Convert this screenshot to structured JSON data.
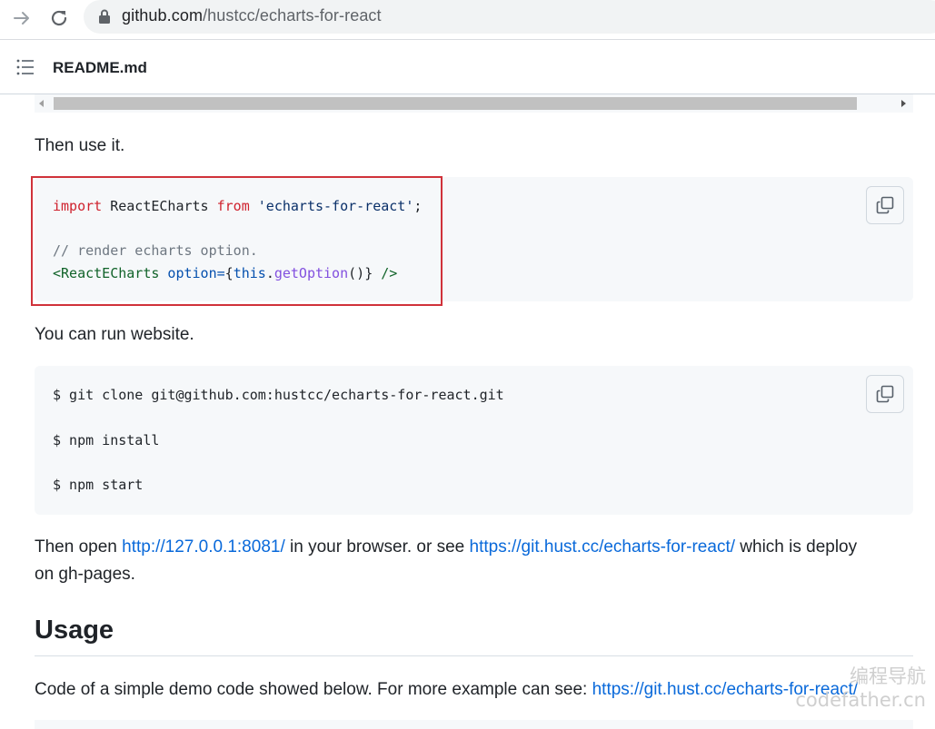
{
  "browser": {
    "url_host": "github.com",
    "url_path": "/hustcc/echarts-for-react"
  },
  "readme": {
    "title": "README.md"
  },
  "content": {
    "then_use_it": "Then use it.",
    "code1": {
      "line1_kw": "import",
      "line1_mid": " ReactECharts ",
      "line1_kw2": "from",
      "line1_str": " 'echarts-for-react'",
      "line1_end": ";",
      "line2": "// render echarts option.",
      "line3_tag": "<ReactECharts",
      "line3_attr": " option=",
      "line3_brace": "{",
      "line3_this": "this",
      "line3_dot": ".",
      "line3_fn": "getOption",
      "line3_call": "()",
      "line3_close": "}",
      "line3_end": " />"
    },
    "you_can_run": "You can run website.",
    "code2": {
      "line1": "$ git clone git@github.com:hustcc/echarts-for-react.git",
      "line2": "$ npm install",
      "line3": "$ npm start"
    },
    "then_open_pre": "Then open ",
    "then_open_link1": "http://127.0.0.1:8081/",
    "then_open_mid": " in your browser. or see ",
    "then_open_link2": "https://git.hust.cc/echarts-for-react/",
    "then_open_post": " which is deploy",
    "then_open_line2": "on gh-pages.",
    "usage_heading": "Usage",
    "usage_text_pre": "Code of a simple demo code showed below. For more example can see: ",
    "usage_text_link": "https://git.hust.cc/echarts-for-react/"
  },
  "watermark": {
    "line1": "编程导航",
    "line2": "codefather.cn"
  }
}
